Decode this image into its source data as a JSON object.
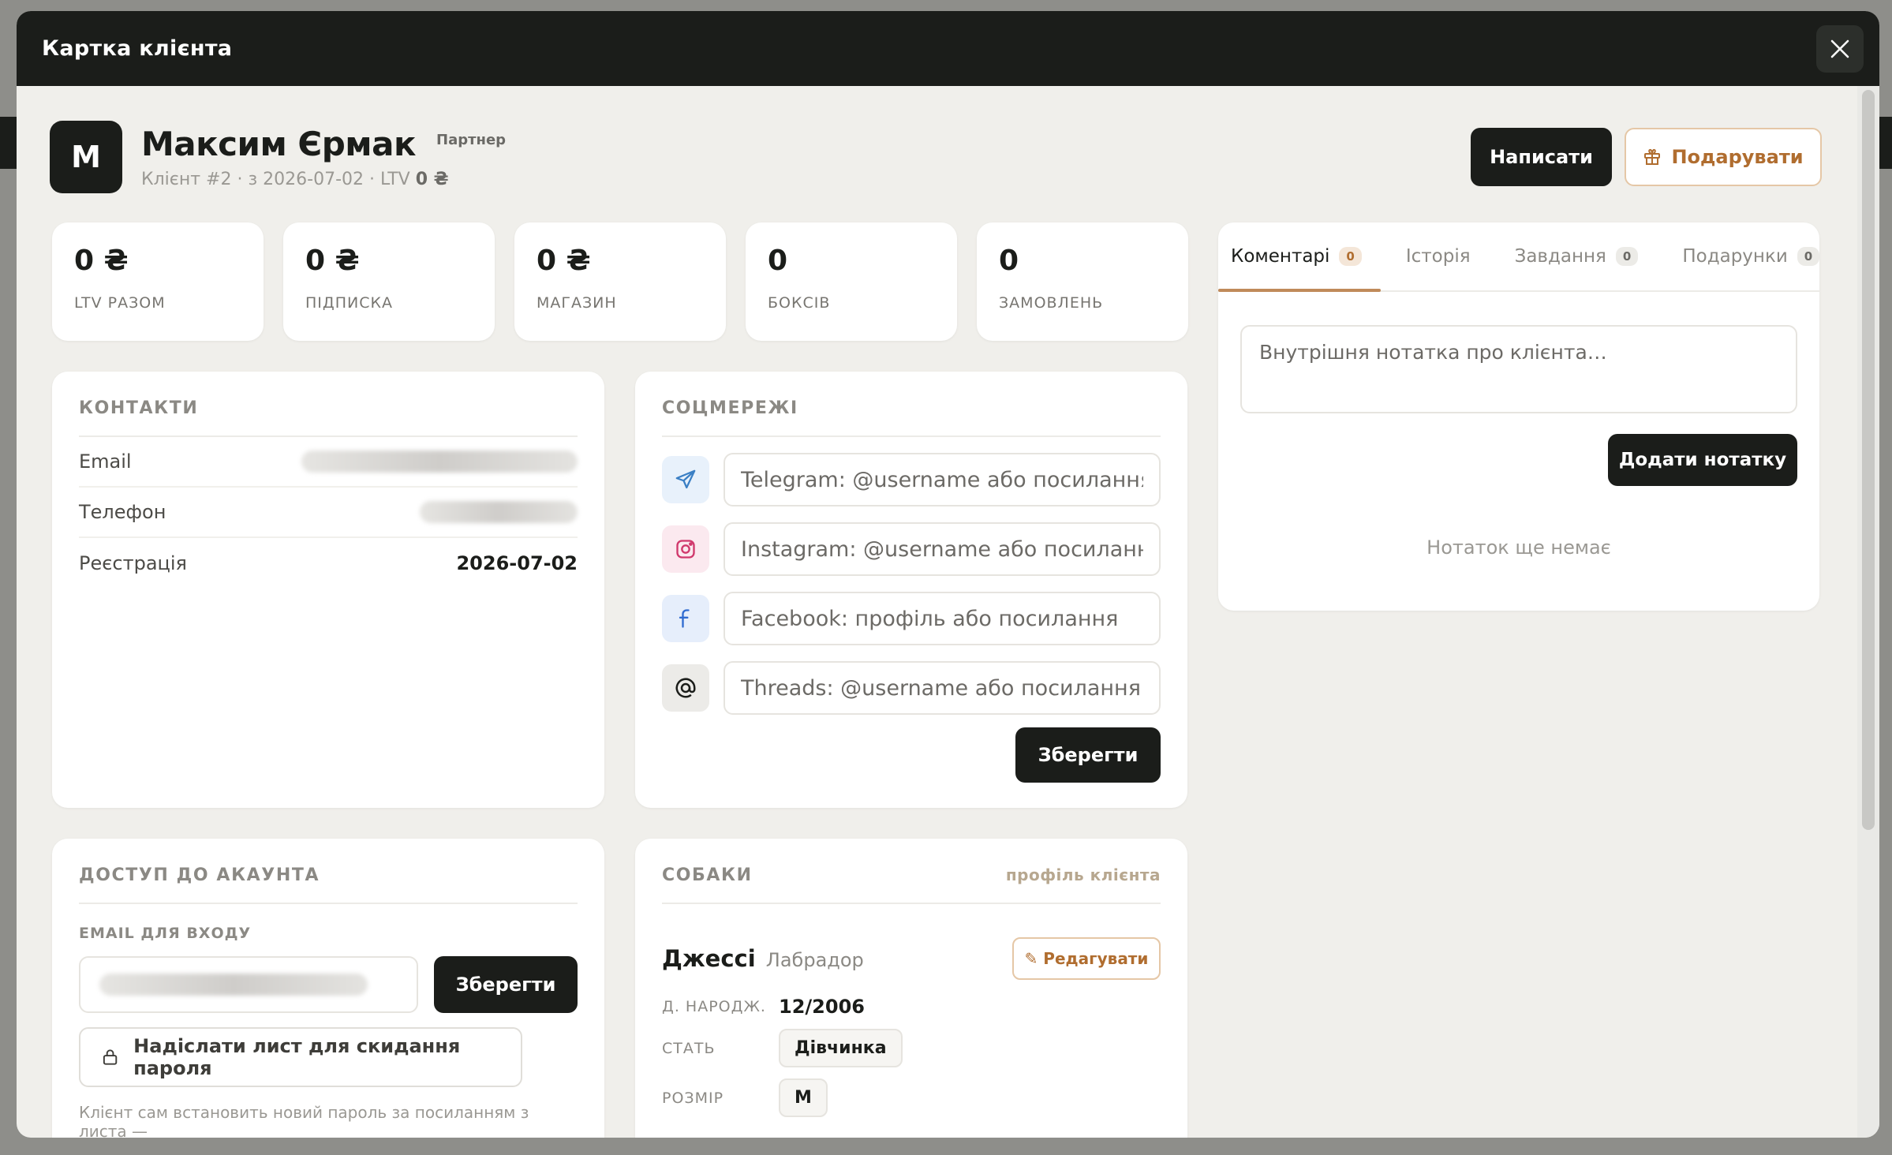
{
  "modal": {
    "title": "Картка клієнта"
  },
  "client": {
    "initial": "М",
    "name": "Максим Єрмак",
    "role": "Партнер",
    "meta_prefix": "Клієнт #2 · з 2026-07-02 · LTV ",
    "meta_ltv": "0 ₴"
  },
  "actions": {
    "write_label": "Написати",
    "gift_label": "Подарувати"
  },
  "stats": [
    {
      "value": "0 ₴",
      "label": "LTV РАЗОМ"
    },
    {
      "value": "0 ₴",
      "label": "ПІДПИСКА"
    },
    {
      "value": "0 ₴",
      "label": "МАГАЗИН"
    },
    {
      "value": "0",
      "label": "БОКСІВ"
    },
    {
      "value": "0",
      "label": "ЗАМОВЛЕНЬ"
    }
  ],
  "contacts": {
    "title": "КОНТАКТИ",
    "rows": [
      {
        "label": "Email",
        "value": ""
      },
      {
        "label": "Телефон",
        "value": ""
      },
      {
        "label": "Реєстрація",
        "value": "2026-07-02"
      }
    ]
  },
  "social": {
    "title": "СОЦМЕРЕЖІ",
    "telegram_placeholder": "Telegram: @username або посилання",
    "instagram_placeholder": "Instagram: @username або посилання",
    "facebook_placeholder": "Facebook: профіль або посилання",
    "threads_placeholder": "Threads: @username або посилання",
    "save_label": "Зберегти"
  },
  "notes": {
    "tabs": [
      {
        "label": "Коментарі",
        "count": "0"
      },
      {
        "label": "Історія",
        "count": ""
      },
      {
        "label": "Завдання",
        "count": "0"
      },
      {
        "label": "Подарунки",
        "count": "0"
      }
    ],
    "placeholder": "Внутрішня нотатка про клієнта…",
    "add_label": "Додати нотатку",
    "empty_text": "Нотаток ще немає"
  },
  "access": {
    "title": "ДОСТУП ДО АКАУНТА",
    "email_label": "EMAIL ДЛЯ ВХОДУ",
    "save_label": "Зберегти",
    "reset_label": "Надіслати лист для скидання пароля",
    "hint": "Клієнт сам встановить новий пароль за посиланням з листа —"
  },
  "dogs": {
    "title": "СОБАКИ",
    "profile_link": "профіль клієнта",
    "dog_name": "Джессі",
    "dog_breed": "Лабрадор",
    "edit_label": "✎ Редагувати",
    "birth_label": "Д. НАРОДЖ.",
    "birth_value": "12/2006",
    "sex_label": "СТАТЬ",
    "sex_value": "Дівчинка",
    "size_label": "РОЗМІР",
    "size_value": "M"
  },
  "colors": {
    "dark": "#1b1d1a",
    "accent": "#b06d2f",
    "background": "#f0efeb"
  }
}
